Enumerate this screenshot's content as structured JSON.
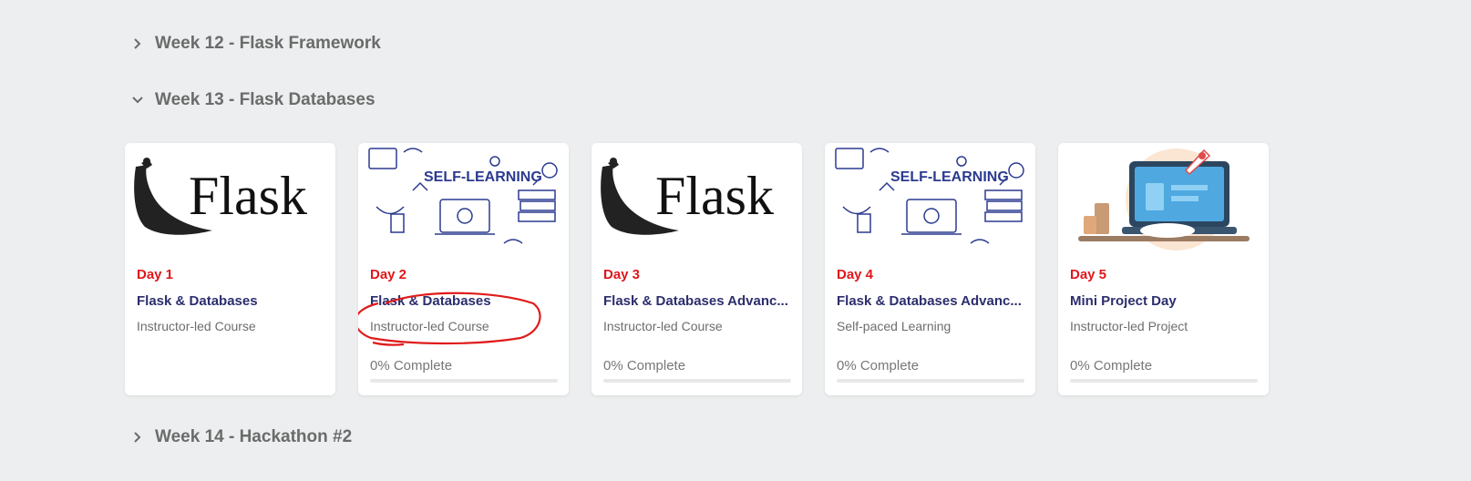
{
  "weeks": {
    "week12": {
      "label": "Week 12 - Flask Framework",
      "expanded": false
    },
    "week13": {
      "label": "Week 13 - Flask Databases",
      "expanded": true
    },
    "week14": {
      "label": "Week 14 - Hackathon #2",
      "expanded": false
    }
  },
  "cards": [
    {
      "day": "Day 1",
      "title": "Flask & Databases",
      "type": "Instructor-led Course",
      "thumb": "flask-logo"
    },
    {
      "day": "Day 2",
      "title": "Flask & Databases",
      "type": "Instructor-led Course",
      "thumb": "self-learning",
      "progress_label": "0% Complete",
      "progress": 0
    },
    {
      "day": "Day 3",
      "title": "Flask & Databases Advanc...",
      "type": "Instructor-led Course",
      "thumb": "flask-logo",
      "progress_label": "0% Complete",
      "progress": 0
    },
    {
      "day": "Day 4",
      "title": "Flask & Databases Advanc...",
      "type": "Self-paced Learning",
      "thumb": "self-learning",
      "progress_label": "0% Complete",
      "progress": 0
    },
    {
      "day": "Day 5",
      "title": "Mini Project Day",
      "type": "Instructor-led Project",
      "thumb": "rocket-laptop",
      "progress_label": "0% Complete",
      "progress": 0
    }
  ],
  "thumbs": {
    "flask_text": "Flask",
    "self_learning_text": "SELF-LEARNING"
  },
  "colors": {
    "day": "#e0161b",
    "title": "#2c2e6e",
    "annotation": "#e01b1b"
  }
}
